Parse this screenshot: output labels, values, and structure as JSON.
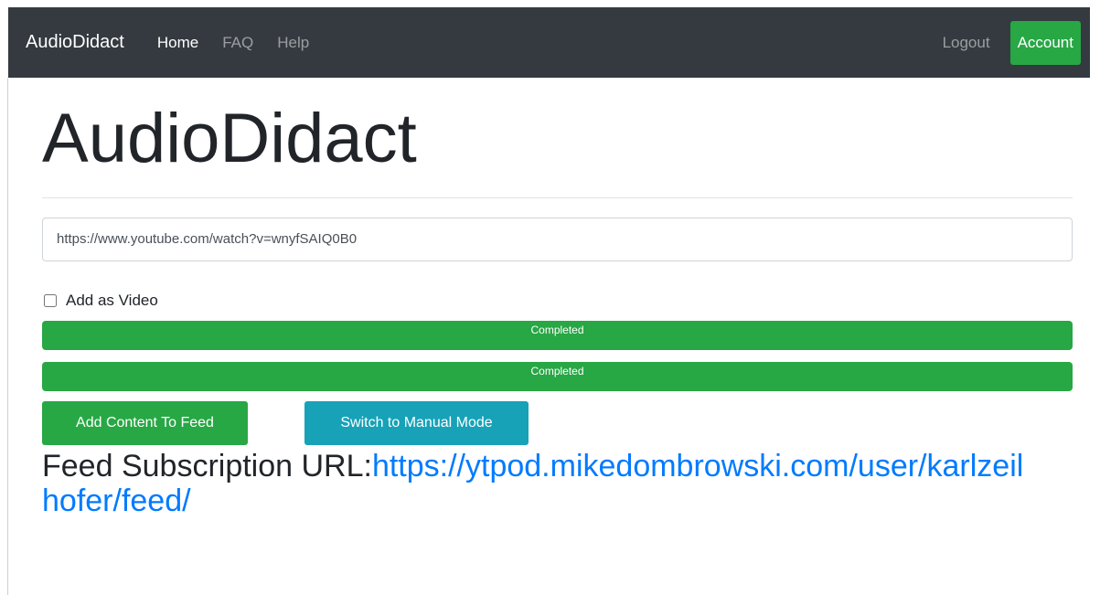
{
  "navbar": {
    "brand": "AudioDidact",
    "links": [
      {
        "label": "Home",
        "active": true
      },
      {
        "label": "FAQ",
        "active": false
      },
      {
        "label": "Help",
        "active": false
      }
    ],
    "logout_label": "Logout",
    "account_label": "Account"
  },
  "main": {
    "title": "AudioDidact",
    "url_input": {
      "value": "https://www.youtube.com/watch?v=wnyfSAIQ0B0"
    },
    "checkbox": {
      "label": "Add as Video",
      "checked": false
    },
    "progress_bars": [
      {
        "label": "Completed",
        "value": 100
      },
      {
        "label": "Completed",
        "value": 100
      }
    ],
    "buttons": {
      "add_content": "Add Content To Feed",
      "manual_mode": "Switch to Manual Mode"
    },
    "feed": {
      "label": "Feed Subscription URL:",
      "url": "https://ytpod.mikedombrowski.com/user/karlzeilhofer/feed/"
    }
  },
  "colors": {
    "navbar_bg": "#343a40",
    "success": "#28a745",
    "info": "#17a2b8",
    "link": "#007bff"
  }
}
